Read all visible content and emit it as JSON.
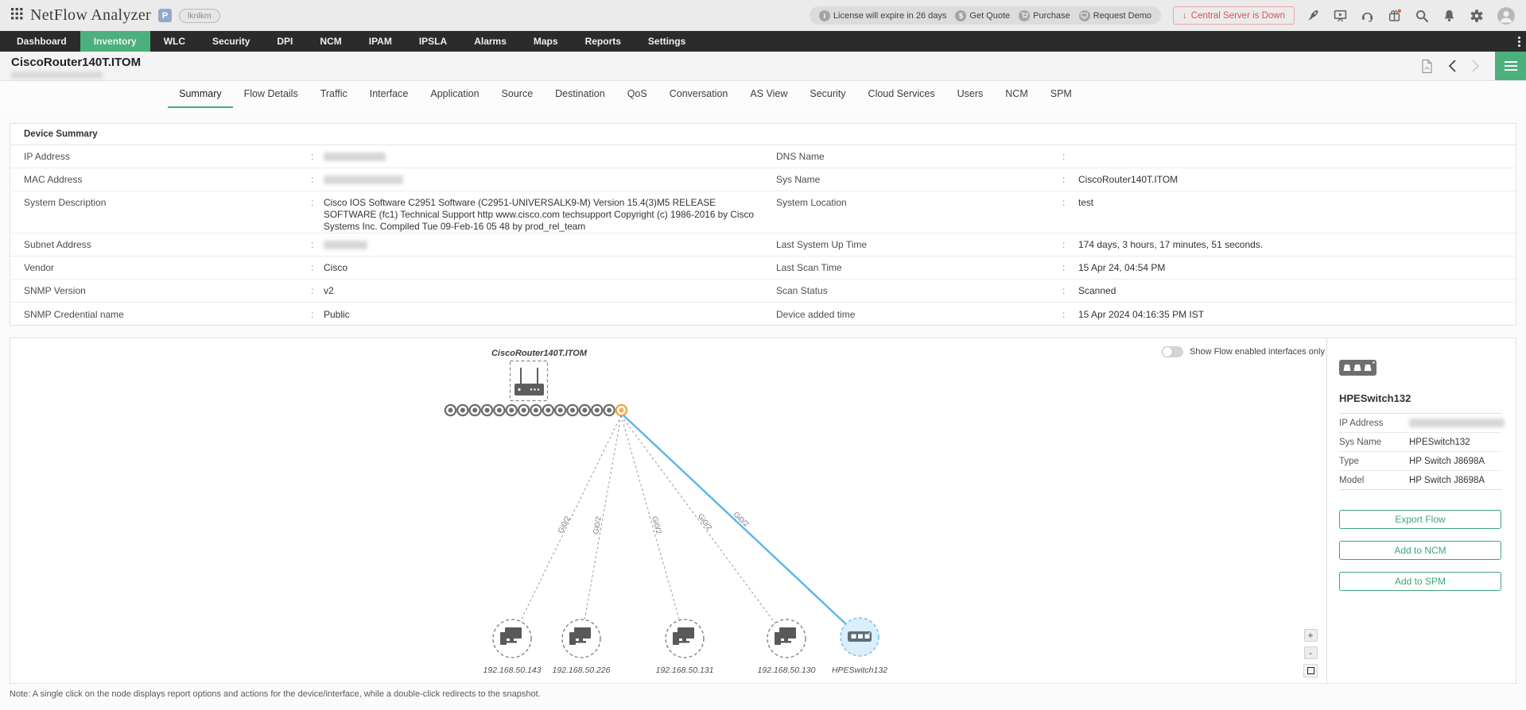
{
  "header": {
    "app_title": "NetFlow Analyzer",
    "edition_badge": "P",
    "user_badge": "lknlkm",
    "license_warning": "License will expire in 26 days",
    "get_quote_label": "Get Quote",
    "purchase_label": "Purchase",
    "request_demo_label": "Request Demo",
    "central_server_label": "Central Server is Down"
  },
  "nav": {
    "tabs": [
      {
        "label": "Dashboard"
      },
      {
        "label": "Inventory",
        "active": true
      },
      {
        "label": "WLC"
      },
      {
        "label": "Security"
      },
      {
        "label": "DPI"
      },
      {
        "label": "NCM"
      },
      {
        "label": "IPAM"
      },
      {
        "label": "IPSLA"
      },
      {
        "label": "Alarms"
      },
      {
        "label": "Maps"
      },
      {
        "label": "Reports"
      },
      {
        "label": "Settings"
      }
    ]
  },
  "page": {
    "title": "CiscoRouter140T.ITOM"
  },
  "subtabs": [
    {
      "label": "Summary",
      "active": true
    },
    {
      "label": "Flow Details"
    },
    {
      "label": "Traffic"
    },
    {
      "label": "Interface"
    },
    {
      "label": "Application"
    },
    {
      "label": "Source"
    },
    {
      "label": "Destination"
    },
    {
      "label": "QoS"
    },
    {
      "label": "Conversation"
    },
    {
      "label": "AS View"
    },
    {
      "label": "Security"
    },
    {
      "label": "Cloud Services"
    },
    {
      "label": "Users"
    },
    {
      "label": "NCM"
    },
    {
      "label": "SPM"
    }
  ],
  "device_summary": {
    "title": "Device Summary",
    "left_rows": [
      {
        "label": "IP Address",
        "redacted": true
      },
      {
        "label": "MAC Address",
        "redacted": true
      },
      {
        "label": "System Description",
        "value": "Cisco IOS Software C2951 Software (C2951-UNIVERSALK9-M) Version 15.4(3)M5 RELEASE SOFTWARE (fc1) Technical Support http www.cisco.com techsupport Copyright (c) 1986-2016 by Cisco Systems Inc. Compiled Tue 09-Feb-16 05 48 by prod_rel_team"
      },
      {
        "label": "Subnet Address",
        "redacted": true
      },
      {
        "label": "Vendor",
        "value": "Cisco"
      },
      {
        "label": "SNMP Version",
        "value": "v2"
      },
      {
        "label": "SNMP Credential name",
        "value": "Public"
      }
    ],
    "right_rows": [
      {
        "label": "DNS Name",
        "value": ""
      },
      {
        "label": "Sys Name",
        "value": "CiscoRouter140T.ITOM"
      },
      {
        "label": "System Location",
        "value": "test"
      },
      {
        "label": "Last System Up Time",
        "value": "174 days, 3 hours, 17 minutes, 51 seconds."
      },
      {
        "label": "Last Scan Time",
        "value": "15 Apr 24, 04:54 PM"
      },
      {
        "label": "Scan Status",
        "value": "Scanned"
      },
      {
        "label": "Device added time",
        "value": "15 Apr 2024 04:16:35 PM IST"
      }
    ]
  },
  "topology": {
    "toggle_label": "Show Flow enabled interfaces only",
    "router_label": "CiscoRouter140T.ITOM",
    "ports": {
      "total": 15,
      "selected_index": 14
    },
    "edges": [
      {
        "label": "Gi0/2"
      },
      {
        "label": "Gi0/2"
      },
      {
        "label": "Gi0/2"
      },
      {
        "label": "Gi0/2"
      },
      {
        "label": "Gi0/2",
        "highlighted": true
      }
    ],
    "nodes": [
      {
        "label": "192.168.50.143",
        "type": "pc"
      },
      {
        "label": "192.168.50.226",
        "type": "pc"
      },
      {
        "label": "192.168.50.131",
        "type": "pc"
      },
      {
        "label": "192.168.50.130",
        "type": "pc"
      },
      {
        "label": "HPESwitch132",
        "type": "switch",
        "selected": true
      }
    ],
    "zoom_in_label": "+",
    "zoom_out_label": "-"
  },
  "side_panel": {
    "title": "HPESwitch132",
    "rows": [
      {
        "label": "IP Address",
        "redacted": true
      },
      {
        "label": "Sys Name",
        "value": "HPESwitch132"
      },
      {
        "label": "Type",
        "value": "HP Switch J8698A"
      },
      {
        "label": "Model",
        "value": "HP Switch J8698A"
      }
    ],
    "buttons": [
      "Export Flow",
      "Add to NCM",
      "Add to SPM"
    ]
  },
  "note": "Note: A single click on the node displays report options and actions for the device/interface, while a double-click redirects to the snapshot.",
  "colors": {
    "accent_green": "#4bb07c",
    "selected_port_orange": "#f0a23e",
    "highlight_blue": "#58b5ea",
    "alert_red": "#d9534f",
    "navbar_dark": "#2b2b2b"
  }
}
